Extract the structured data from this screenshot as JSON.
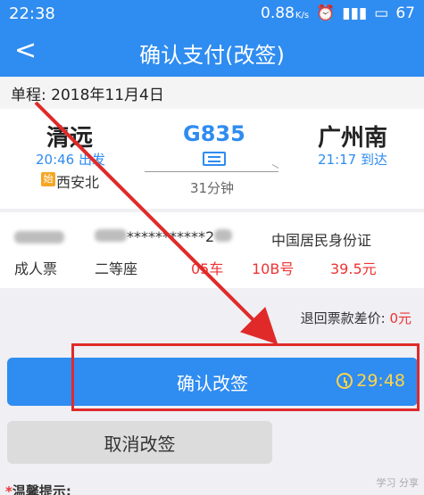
{
  "status": {
    "time": "22:38",
    "speed": "0.88",
    "speed_unit": "K/s",
    "battery": "67"
  },
  "nav": {
    "back_icon": "chevron-left-icon",
    "title": "确认支付(改签)"
  },
  "trip": {
    "date_label": "单程: 2018年11月4日",
    "from": {
      "name": "清远",
      "time": "20:46 出发"
    },
    "to": {
      "name": "广州南",
      "time": "21:17 到达"
    },
    "train_no": "G835",
    "duration": "31分钟",
    "origin_badge": "始",
    "origin_station": "西安北"
  },
  "passenger": {
    "id_masked": "***********2",
    "id_type": "中国居民身份证",
    "ticket_type": "成人票",
    "seat_class": "二等座",
    "car": "05车",
    "seat_no": "10B号",
    "price": "39.5元"
  },
  "refund": {
    "label": "退回票款差价:",
    "value": "0元"
  },
  "buttons": {
    "confirm_label": "确认改签",
    "countdown": "29:48",
    "cancel_label": "取消改签"
  },
  "tip": {
    "star": "*",
    "label": "温馨提示:"
  },
  "watermark": "学习 分享",
  "colors": {
    "primary": "#2f8cf0",
    "annotation_red": "#e02a2a",
    "countdown_yellow": "#ffd54a"
  }
}
